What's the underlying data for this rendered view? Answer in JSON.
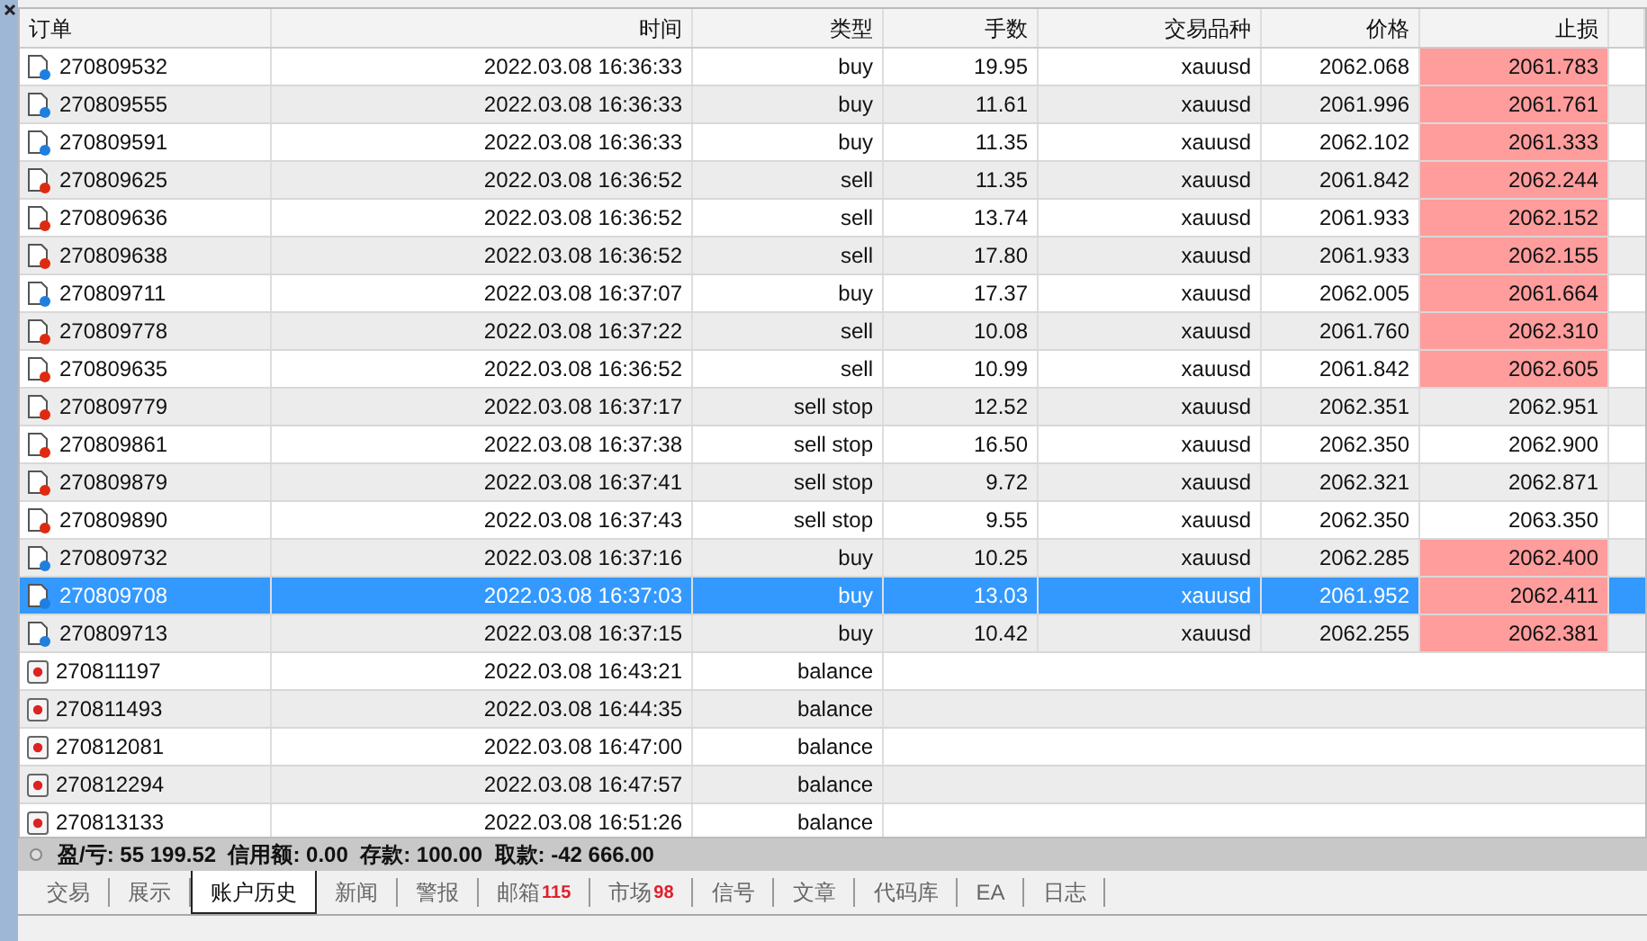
{
  "table": {
    "columns": [
      "订单",
      "时间",
      "类型",
      "手数",
      "交易品种",
      "价格",
      "止损"
    ],
    "rows": [
      {
        "kind": "buy",
        "order": "270809532",
        "time": "2022.03.08 16:36:33",
        "type": "buy",
        "lots": "19.95",
        "symbol": "xauusd",
        "price": "2062.068",
        "sl": "2061.783",
        "sl_alert": true,
        "selected": false
      },
      {
        "kind": "buy",
        "order": "270809555",
        "time": "2022.03.08 16:36:33",
        "type": "buy",
        "lots": "11.61",
        "symbol": "xauusd",
        "price": "2061.996",
        "sl": "2061.761",
        "sl_alert": true,
        "selected": false
      },
      {
        "kind": "buy",
        "order": "270809591",
        "time": "2022.03.08 16:36:33",
        "type": "buy",
        "lots": "11.35",
        "symbol": "xauusd",
        "price": "2062.102",
        "sl": "2061.333",
        "sl_alert": true,
        "selected": false
      },
      {
        "kind": "sell",
        "order": "270809625",
        "time": "2022.03.08 16:36:52",
        "type": "sell",
        "lots": "11.35",
        "symbol": "xauusd",
        "price": "2061.842",
        "sl": "2062.244",
        "sl_alert": true,
        "selected": false
      },
      {
        "kind": "sell",
        "order": "270809636",
        "time": "2022.03.08 16:36:52",
        "type": "sell",
        "lots": "13.74",
        "symbol": "xauusd",
        "price": "2061.933",
        "sl": "2062.152",
        "sl_alert": true,
        "selected": false
      },
      {
        "kind": "sell",
        "order": "270809638",
        "time": "2022.03.08 16:36:52",
        "type": "sell",
        "lots": "17.80",
        "symbol": "xauusd",
        "price": "2061.933",
        "sl": "2062.155",
        "sl_alert": true,
        "selected": false
      },
      {
        "kind": "buy",
        "order": "270809711",
        "time": "2022.03.08 16:37:07",
        "type": "buy",
        "lots": "17.37",
        "symbol": "xauusd",
        "price": "2062.005",
        "sl": "2061.664",
        "sl_alert": true,
        "selected": false
      },
      {
        "kind": "sell",
        "order": "270809778",
        "time": "2022.03.08 16:37:22",
        "type": "sell",
        "lots": "10.08",
        "symbol": "xauusd",
        "price": "2061.760",
        "sl": "2062.310",
        "sl_alert": true,
        "selected": false
      },
      {
        "kind": "sell",
        "order": "270809635",
        "time": "2022.03.08 16:36:52",
        "type": "sell",
        "lots": "10.99",
        "symbol": "xauusd",
        "price": "2061.842",
        "sl": "2062.605",
        "sl_alert": true,
        "selected": false
      },
      {
        "kind": "sell",
        "order": "270809779",
        "time": "2022.03.08 16:37:17",
        "type": "sell stop",
        "lots": "12.52",
        "symbol": "xauusd",
        "price": "2062.351",
        "sl": "2062.951",
        "sl_alert": false,
        "selected": false
      },
      {
        "kind": "sell",
        "order": "270809861",
        "time": "2022.03.08 16:37:38",
        "type": "sell stop",
        "lots": "16.50",
        "symbol": "xauusd",
        "price": "2062.350",
        "sl": "2062.900",
        "sl_alert": false,
        "selected": false
      },
      {
        "kind": "sell",
        "order": "270809879",
        "time": "2022.03.08 16:37:41",
        "type": "sell stop",
        "lots": "9.72",
        "symbol": "xauusd",
        "price": "2062.321",
        "sl": "2062.871",
        "sl_alert": false,
        "selected": false
      },
      {
        "kind": "sell",
        "order": "270809890",
        "time": "2022.03.08 16:37:43",
        "type": "sell stop",
        "lots": "9.55",
        "symbol": "xauusd",
        "price": "2062.350",
        "sl": "2063.350",
        "sl_alert": false,
        "selected": false
      },
      {
        "kind": "buy",
        "order": "270809732",
        "time": "2022.03.08 16:37:16",
        "type": "buy",
        "lots": "10.25",
        "symbol": "xauusd",
        "price": "2062.285",
        "sl": "2062.400",
        "sl_alert": true,
        "selected": false
      },
      {
        "kind": "buy",
        "order": "270809708",
        "time": "2022.03.08 16:37:03",
        "type": "buy",
        "lots": "13.03",
        "symbol": "xauusd",
        "price": "2061.952",
        "sl": "2062.411",
        "sl_alert": true,
        "selected": true
      },
      {
        "kind": "buy",
        "order": "270809713",
        "time": "2022.03.08 16:37:15",
        "type": "buy",
        "lots": "10.42",
        "symbol": "xauusd",
        "price": "2062.255",
        "sl": "2062.381",
        "sl_alert": true,
        "selected": false
      },
      {
        "kind": "balance",
        "order": "270811197",
        "time": "2022.03.08 16:43:21",
        "type": "balance",
        "selected": false
      },
      {
        "kind": "balance",
        "order": "270811493",
        "time": "2022.03.08 16:44:35",
        "type": "balance",
        "selected": false
      },
      {
        "kind": "balance",
        "order": "270812081",
        "time": "2022.03.08 16:47:00",
        "type": "balance",
        "selected": false
      },
      {
        "kind": "balance",
        "order": "270812294",
        "time": "2022.03.08 16:47:57",
        "type": "balance",
        "selected": false
      },
      {
        "kind": "balance",
        "order": "270813133",
        "time": "2022.03.08 16:51:26",
        "type": "balance",
        "selected": false
      }
    ]
  },
  "summary": "盈/亏: 55 199.52  信用额: 0.00  存款: 100.00  取款: -42 666.00",
  "tabs": [
    {
      "label": "交易",
      "selected": false
    },
    {
      "label": "展示",
      "selected": false
    },
    {
      "label": "账户历史",
      "selected": true
    },
    {
      "label": "新闻",
      "selected": false
    },
    {
      "label": "警报",
      "selected": false
    },
    {
      "label": "邮箱",
      "badge": "115",
      "selected": false
    },
    {
      "label": "市场",
      "badge": "98",
      "selected": false
    },
    {
      "label": "信号",
      "selected": false
    },
    {
      "label": "文章",
      "selected": false
    },
    {
      "label": "代码库",
      "selected": false
    },
    {
      "label": "EA",
      "selected": false
    },
    {
      "label": "日志",
      "selected": false
    }
  ]
}
